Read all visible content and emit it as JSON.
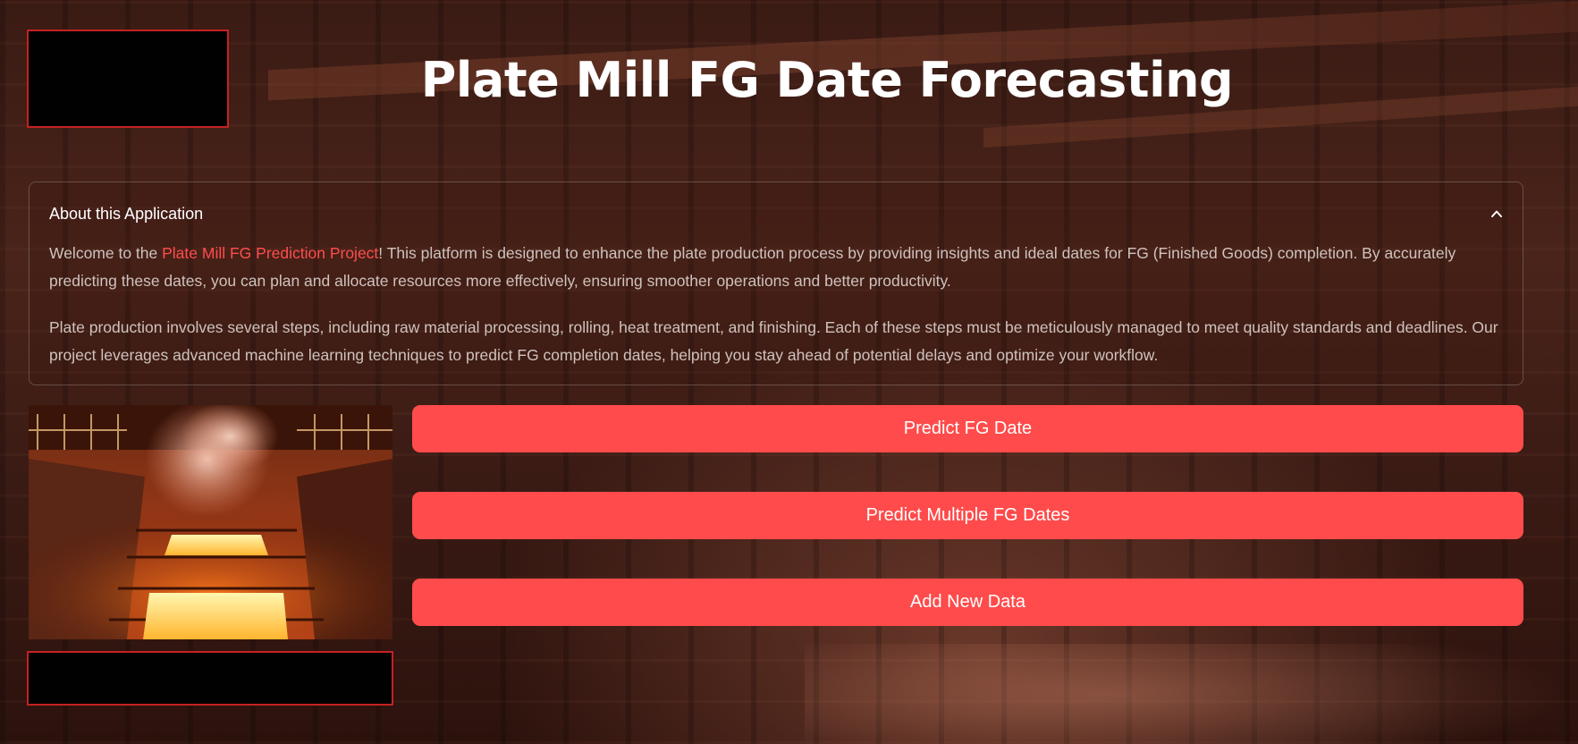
{
  "app": {
    "title": "Plate Mill FG Date Forecasting"
  },
  "about": {
    "header": "About this Application",
    "expanded": true,
    "chevron_icon": "chevron-up-icon",
    "paragraph1_prefix": "Welcome to the ",
    "paragraph1_highlight": "Plate Mill FG Prediction Project",
    "paragraph1_suffix": "! This platform is designed to enhance the plate production process by providing insights and ideal dates for FG (Finished Goods) completion. By accurately predicting these dates, you can plan and allocate resources more effectively, ensuring smoother operations and better productivity.",
    "paragraph2": "Plate production involves several steps, including raw material processing, rolling, heat treatment, and finishing. Each of these steps must be meticulously managed to meet quality standards and deadlines. Our project leverages advanced machine learning techniques to predict FG completion dates, helping you stay ahead of potential delays and optimize your workflow."
  },
  "actions": {
    "predict_single": "Predict FG Date",
    "predict_multiple": "Predict Multiple FG Dates",
    "add_data": "Add New Data"
  },
  "colors": {
    "accent": "#ff4b4b",
    "highlight_text": "#ff4d4d",
    "box_border": "#c42222"
  }
}
